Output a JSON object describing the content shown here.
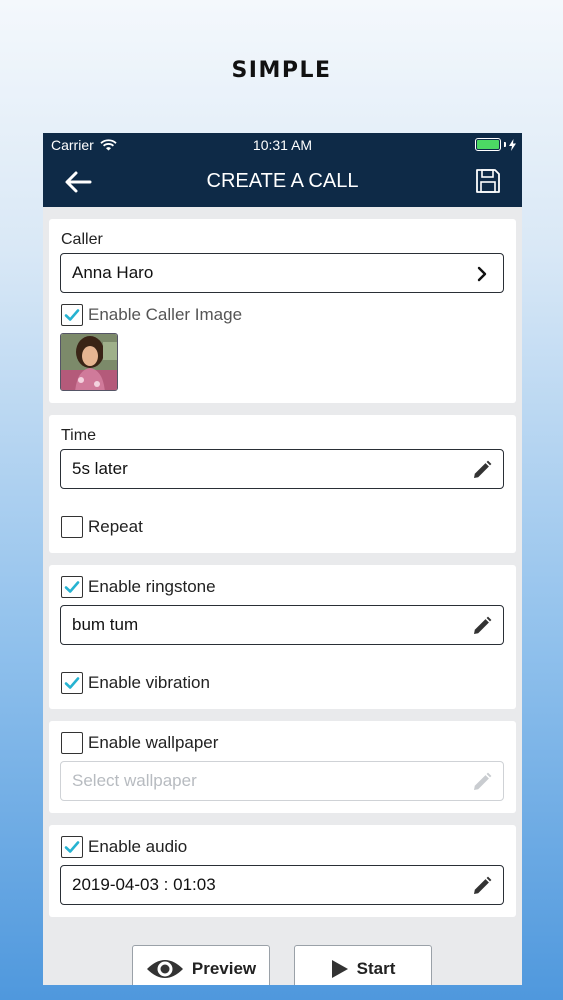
{
  "promo": {
    "title": "SIMPLE"
  },
  "status_bar": {
    "carrier": "Carrier",
    "time": "10:31 AM"
  },
  "nav": {
    "title": "CREATE A CALL",
    "back_icon": "arrow-left-icon",
    "save_icon": "floppy-disk-icon"
  },
  "caller_section": {
    "label": "Caller",
    "caller_name": "Anna Haro",
    "enable_image_label": "Enable Caller Image",
    "enable_image_checked": true
  },
  "time_section": {
    "label": "Time",
    "value": "5s later",
    "repeat_label": "Repeat",
    "repeat_checked": false
  },
  "ringtone_section": {
    "enable_label": "Enable ringstone",
    "enable_checked": true,
    "value": "bum tum",
    "vibration_label": "Enable vibration",
    "vibration_checked": true
  },
  "wallpaper_section": {
    "enable_label": "Enable wallpaper",
    "enable_checked": false,
    "placeholder": "Select wallpaper"
  },
  "audio_section": {
    "enable_label": "Enable audio",
    "enable_checked": true,
    "value": "2019-04-03 : 01:03"
  },
  "actions": {
    "preview_label": "Preview",
    "start_label": "Start"
  },
  "colors": {
    "nav_bg": "#0e2a47",
    "check_accent": "#26b3d1",
    "battery": "#4cd964"
  }
}
